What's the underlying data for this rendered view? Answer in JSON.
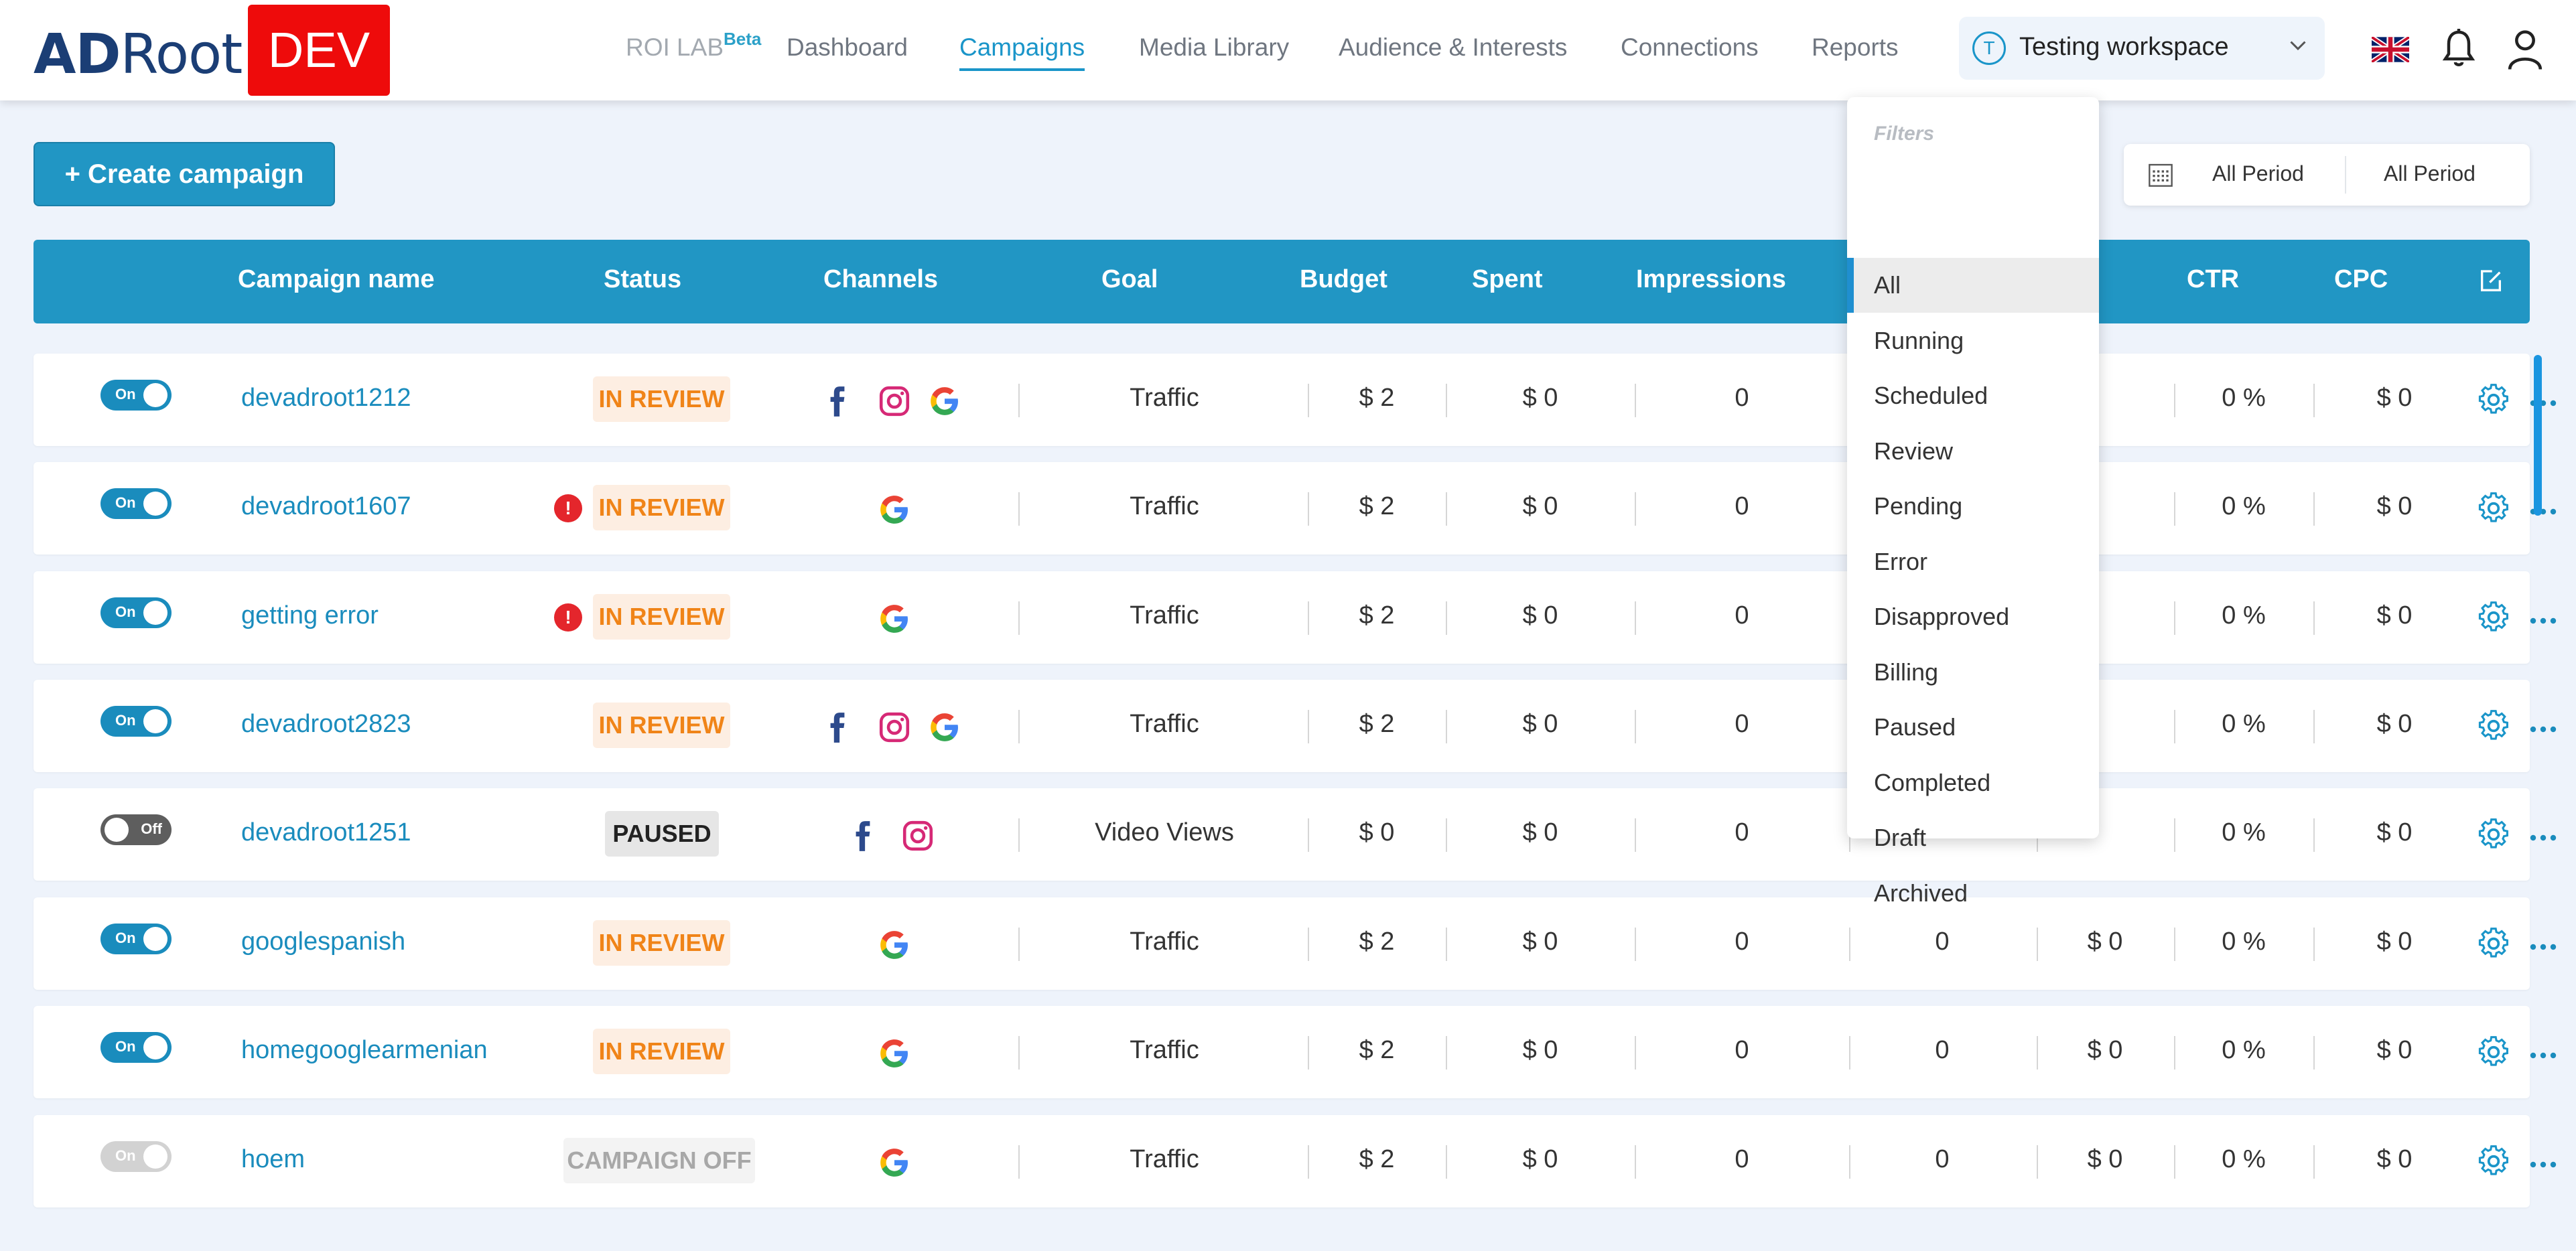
{
  "brand": {
    "logo_ad": "AD",
    "logo_root": "Root",
    "env_badge": "DEV"
  },
  "nav": {
    "roi_lab": "ROI LAB",
    "roi_beta": "Beta",
    "items": [
      "Dashboard",
      "Campaigns",
      "Media Library",
      "Audience & Interests",
      "Connections",
      "Reports"
    ],
    "active": "Campaigns"
  },
  "workspace": {
    "initial": "T",
    "name": "Testing workspace"
  },
  "header_icons": [
    "uk-flag-icon",
    "bell-icon",
    "user-icon"
  ],
  "toolbar": {
    "create_label": "+ Create campaign",
    "period_start": "All Period",
    "period_end": "All Period"
  },
  "table": {
    "columns": [
      "Campaign name",
      "Status",
      "Channels",
      "Goal",
      "Budget",
      "Spent",
      "Impressions",
      "CTR",
      "CPC"
    ],
    "rows": [
      {
        "toggle": "On",
        "toggle_state": "on",
        "name": "devadroot1212",
        "alert": false,
        "status": "IN REVIEW",
        "status_type": "review",
        "channels": [
          "facebook",
          "instagram",
          "google"
        ],
        "goal": "Traffic",
        "budget": "$ 2",
        "spent": "$ 0",
        "impressions": "0",
        "clicks": "",
        "cost": "",
        "ctr": "0 %",
        "cpc": "$ 0"
      },
      {
        "toggle": "On",
        "toggle_state": "on",
        "name": "devadroot1607",
        "alert": true,
        "status": "IN REVIEW",
        "status_type": "review",
        "channels": [
          "google"
        ],
        "goal": "Traffic",
        "budget": "$ 2",
        "spent": "$ 0",
        "impressions": "0",
        "clicks": "",
        "cost": "",
        "ctr": "0 %",
        "cpc": "$ 0"
      },
      {
        "toggle": "On",
        "toggle_state": "on",
        "name": "getting error",
        "alert": true,
        "status": "IN REVIEW",
        "status_type": "review",
        "channels": [
          "google"
        ],
        "goal": "Traffic",
        "budget": "$ 2",
        "spent": "$ 0",
        "impressions": "0",
        "clicks": "",
        "cost": "",
        "ctr": "0 %",
        "cpc": "$ 0"
      },
      {
        "toggle": "On",
        "toggle_state": "on",
        "name": "devadroot2823",
        "alert": false,
        "status": "IN REVIEW",
        "status_type": "review",
        "channels": [
          "facebook",
          "instagram",
          "google"
        ],
        "goal": "Traffic",
        "budget": "$ 2",
        "spent": "$ 0",
        "impressions": "0",
        "clicks": "",
        "cost": "",
        "ctr": "0 %",
        "cpc": "$ 0"
      },
      {
        "toggle": "Off",
        "toggle_state": "off",
        "name": "devadroot1251",
        "alert": false,
        "status": "PAUSED",
        "status_type": "paused",
        "channels": [
          "facebook",
          "instagram"
        ],
        "goal": "Video Views",
        "budget": "$ 0",
        "spent": "$ 0",
        "impressions": "0",
        "clicks": "",
        "cost": "",
        "ctr": "0 %",
        "cpc": "$ 0"
      },
      {
        "toggle": "On",
        "toggle_state": "on",
        "name": "googlespanish",
        "alert": false,
        "status": "IN REVIEW",
        "status_type": "review",
        "channels": [
          "google"
        ],
        "goal": "Traffic",
        "budget": "$ 2",
        "spent": "$ 0",
        "impressions": "0",
        "clicks": "0",
        "cost": "$ 0",
        "ctr": "0 %",
        "cpc": "$ 0"
      },
      {
        "toggle": "On",
        "toggle_state": "on",
        "name": "homegooglearmenian",
        "alert": false,
        "status": "IN REVIEW",
        "status_type": "review",
        "channels": [
          "google"
        ],
        "goal": "Traffic",
        "budget": "$ 2",
        "spent": "$ 0",
        "impressions": "0",
        "clicks": "0",
        "cost": "$ 0",
        "ctr": "0 %",
        "cpc": "$ 0"
      },
      {
        "toggle": "On",
        "toggle_state": "disabled",
        "name": "hoem",
        "alert": false,
        "status": "CAMPAIGN OFF",
        "status_type": "off",
        "channels": [
          "google"
        ],
        "goal": "Traffic",
        "budget": "$ 2",
        "spent": "$ 0",
        "impressions": "0",
        "clicks": "0",
        "cost": "$ 0",
        "ctr": "0 %",
        "cpc": "$ 0"
      }
    ]
  },
  "filters": {
    "title": "Filters",
    "options": [
      "All",
      "Running",
      "Scheduled",
      "Review",
      "Pending",
      "Error",
      "Disapproved",
      "Billing",
      "Paused",
      "Completed",
      "Draft",
      "Archived"
    ],
    "selected": "All"
  },
  "colors": {
    "accent": "#2196c4",
    "review_text": "#f08418",
    "review_bg": "#fdeee2",
    "error_red": "#e4262c",
    "dev_red": "#ee0b0b"
  }
}
